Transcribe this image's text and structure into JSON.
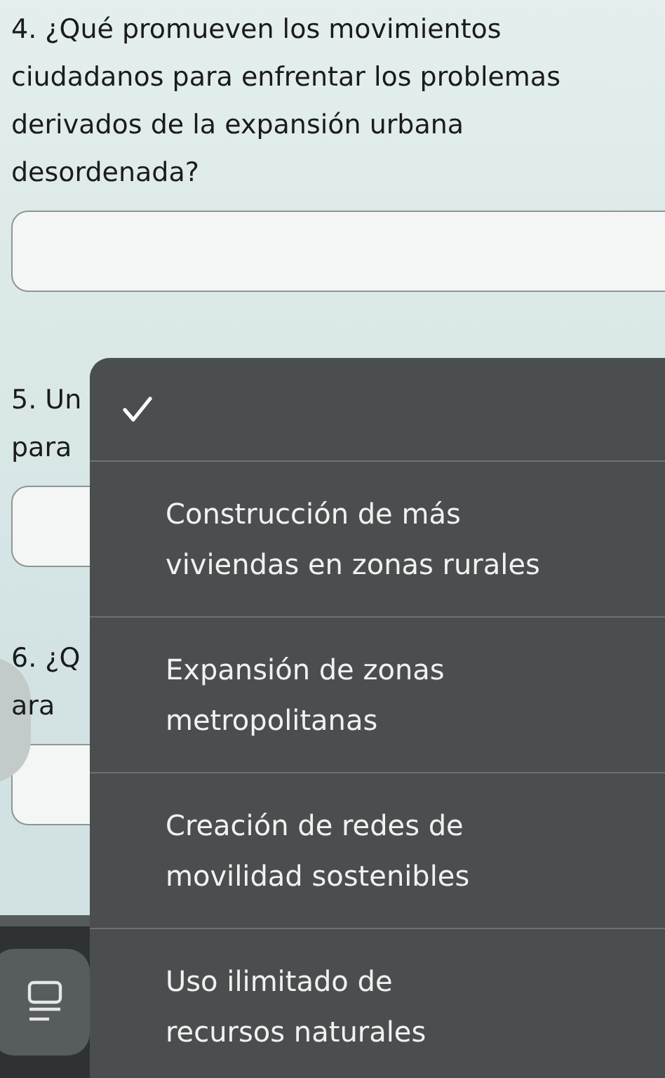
{
  "questions": [
    {
      "lines": [
        "4. ¿Qué promueven los movimientos ciudadanos para enfrentar los problemas derivados de la expansión urbana desordenada?"
      ]
    },
    {
      "lines": [
        "5. Un",
        "para"
      ]
    },
    {
      "lines": [
        "6. ¿Q",
        "ara"
      ]
    }
  ],
  "menu": {
    "options": [
      {
        "kind": "blank",
        "selected": true
      },
      {
        "kind": "text",
        "lines": [
          "Construcción de más",
          "viviendas en zonas rurales"
        ],
        "selected": false
      },
      {
        "kind": "text",
        "lines": [
          "Expansión de zonas",
          "metropolitanas"
        ],
        "selected": false
      },
      {
        "kind": "text",
        "lines": [
          "Creación de redes de",
          "movilidad sostenibles"
        ],
        "selected": false
      },
      {
        "kind": "text",
        "lines": [
          "Uso ilimitado de",
          "recursos naturales"
        ],
        "selected": false
      }
    ]
  }
}
